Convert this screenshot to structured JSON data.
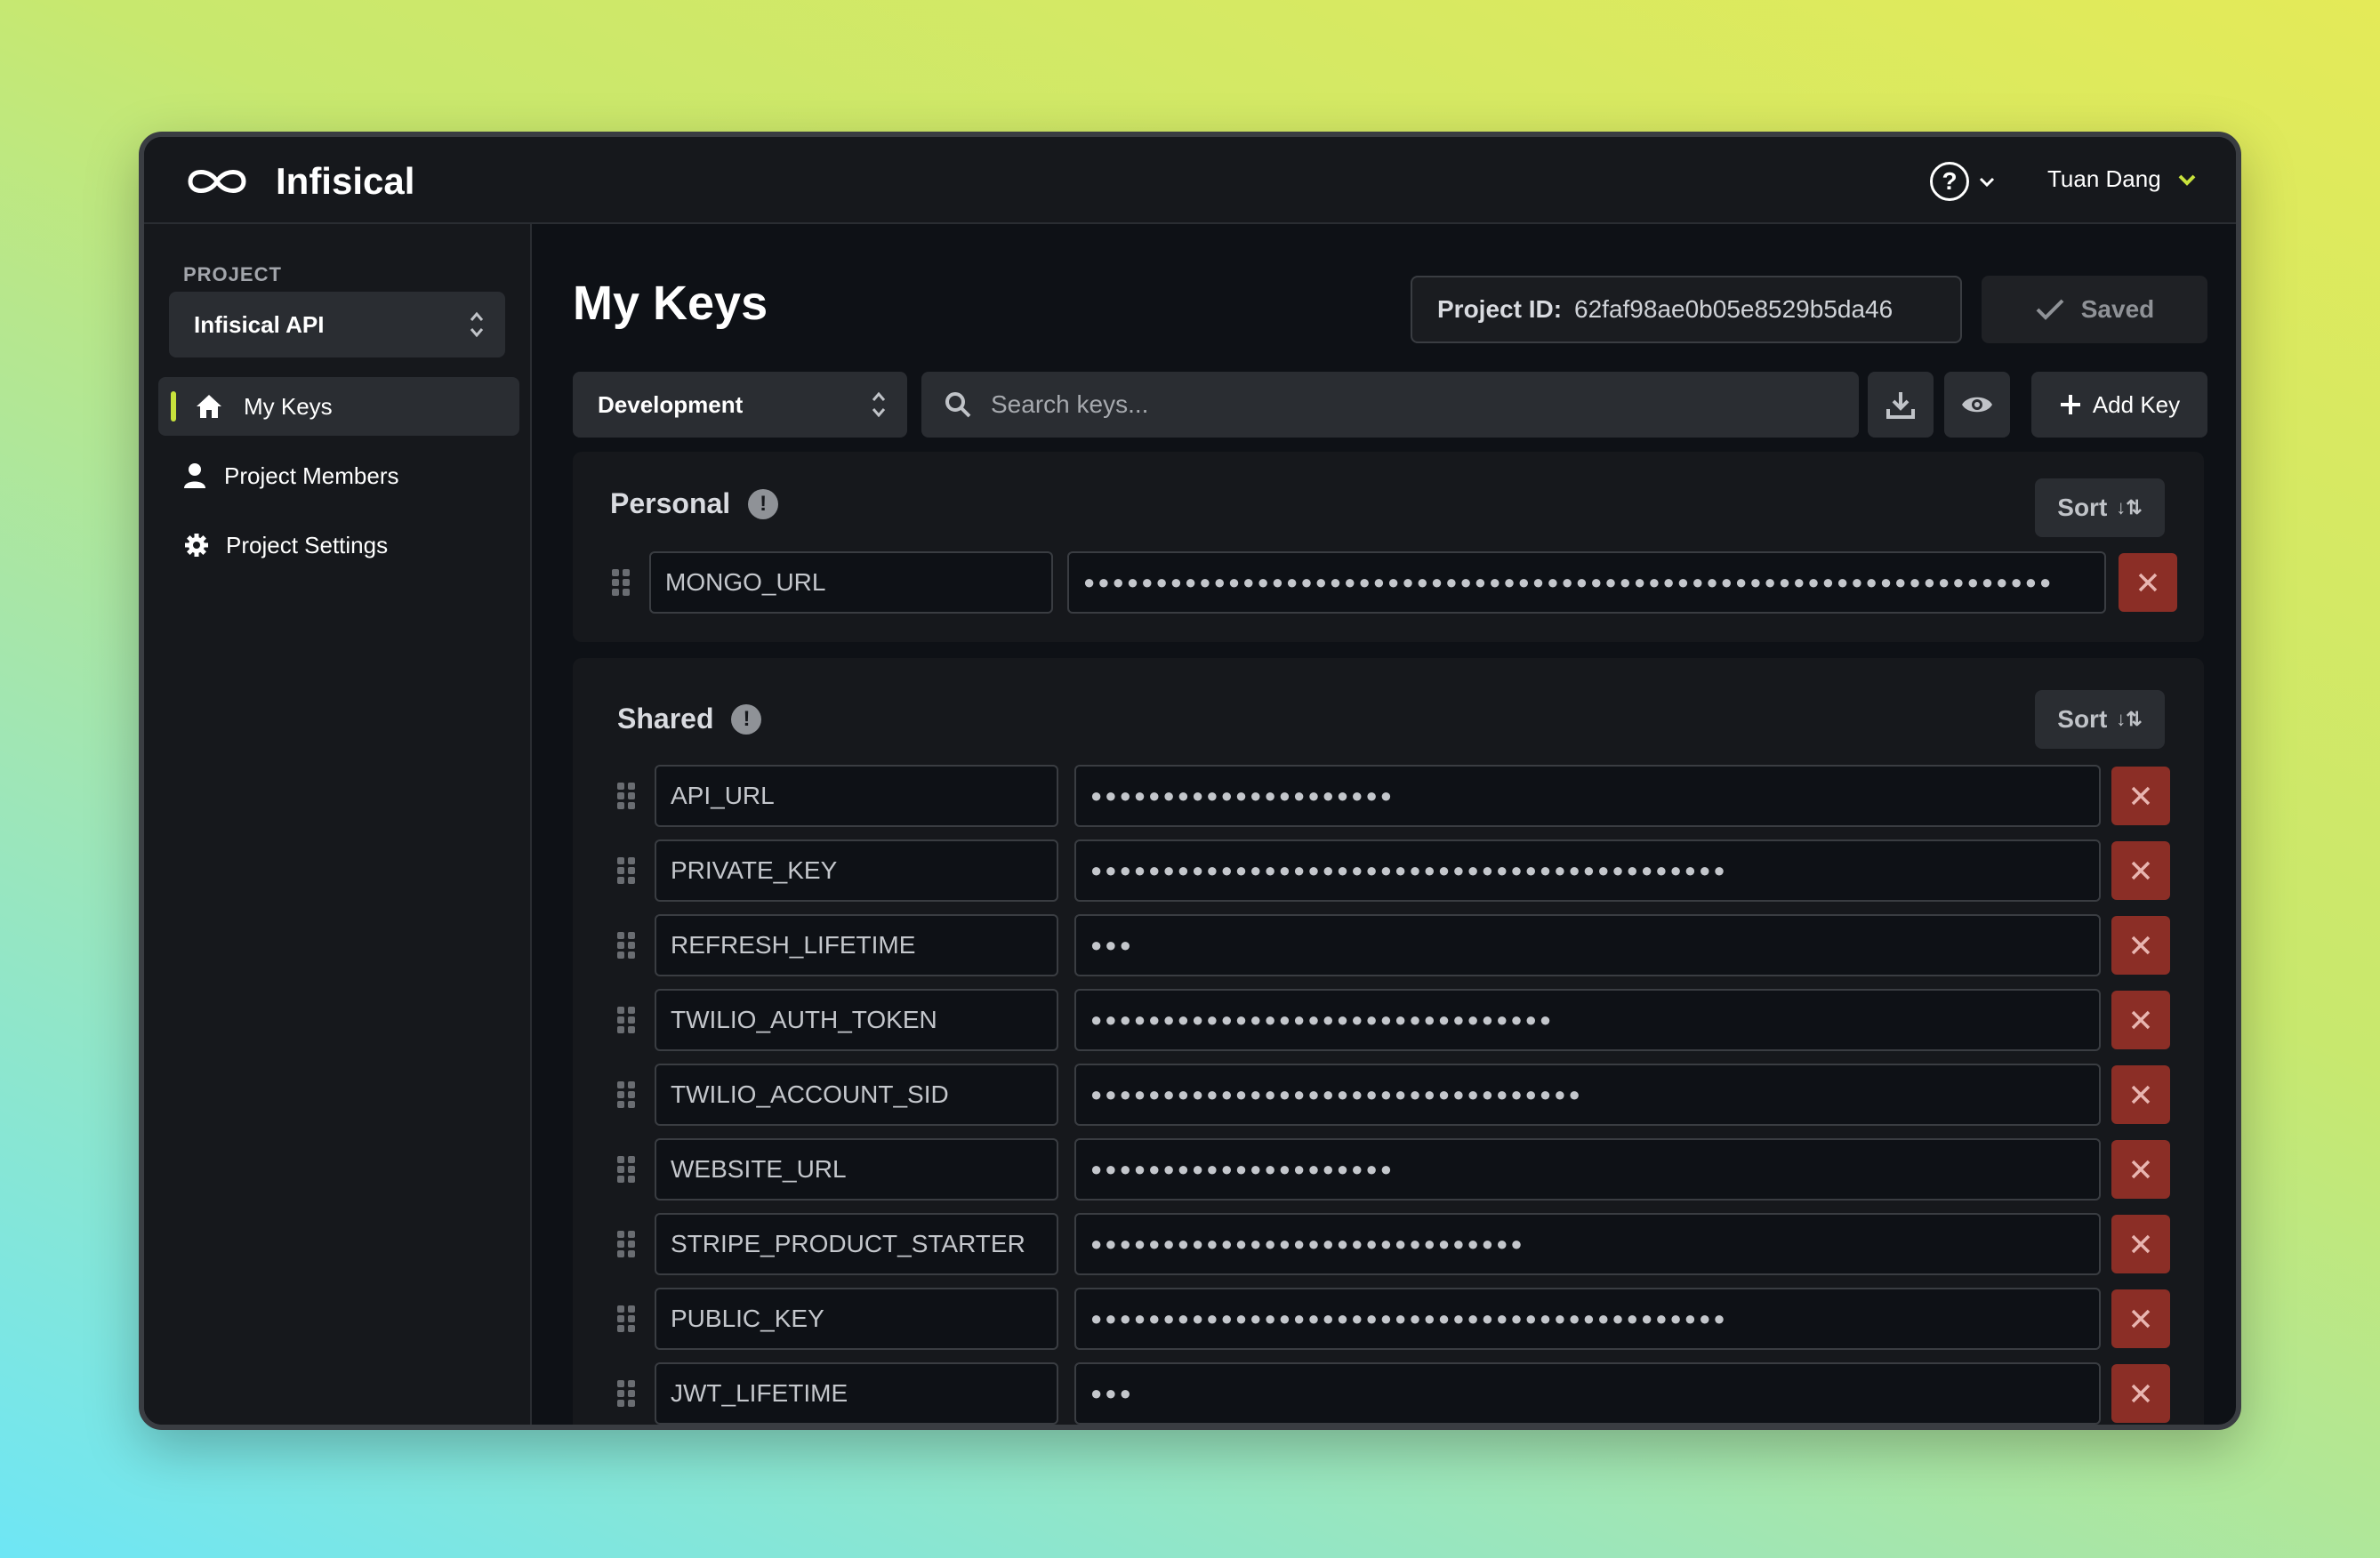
{
  "app": {
    "name": "Infisical"
  },
  "header": {
    "user_name": "Tuan Dang",
    "help_icon": "?",
    "chevron": "⌄"
  },
  "sidebar": {
    "project_label": "PROJECT",
    "project_name": "Infisical API",
    "items": [
      {
        "label": "My Keys",
        "icon": "home-icon",
        "active": true
      },
      {
        "label": "Project Members",
        "icon": "user-icon",
        "active": false
      },
      {
        "label": "Project Settings",
        "icon": "gear-icon",
        "active": false
      }
    ]
  },
  "main": {
    "title": "My Keys",
    "project_id_label": "Project ID:",
    "project_id_value": "62faf98ae0b05e8529b5da46",
    "saved_label": "Saved",
    "environment": "Development",
    "search_placeholder": "Search keys...",
    "add_key_label": "Add Key",
    "sort_label": "Sort",
    "accent_color": "#c8e23c",
    "delete_color": "#8b2e26"
  },
  "personal": {
    "title": "Personal",
    "rows": [
      {
        "key": "MONGO_URL",
        "value": "●●●●●●●●●●●●●●●●●●●●●●●●●●●●●●●●●●●●●●●●●●●●●●●●●●●●●●●●●●●●●●●●●●●"
      }
    ]
  },
  "shared": {
    "title": "Shared",
    "rows": [
      {
        "key": "API_URL",
        "value": "●●●●●●●●●●●●●●●●●●●●●"
      },
      {
        "key": "PRIVATE_KEY",
        "value": "●●●●●●●●●●●●●●●●●●●●●●●●●●●●●●●●●●●●●●●●●●●●"
      },
      {
        "key": "REFRESH_LIFETIME",
        "value": "●●●"
      },
      {
        "key": "TWILIO_AUTH_TOKEN",
        "value": "●●●●●●●●●●●●●●●●●●●●●●●●●●●●●●●●"
      },
      {
        "key": "TWILIO_ACCOUNT_SID",
        "value": "●●●●●●●●●●●●●●●●●●●●●●●●●●●●●●●●●●"
      },
      {
        "key": "WEBSITE_URL",
        "value": "●●●●●●●●●●●●●●●●●●●●●"
      },
      {
        "key": "STRIPE_PRODUCT_STARTER",
        "value": "●●●●●●●●●●●●●●●●●●●●●●●●●●●●●●"
      },
      {
        "key": "PUBLIC_KEY",
        "value": "●●●●●●●●●●●●●●●●●●●●●●●●●●●●●●●●●●●●●●●●●●●●"
      },
      {
        "key": "JWT_LIFETIME",
        "value": "●●●"
      }
    ]
  }
}
